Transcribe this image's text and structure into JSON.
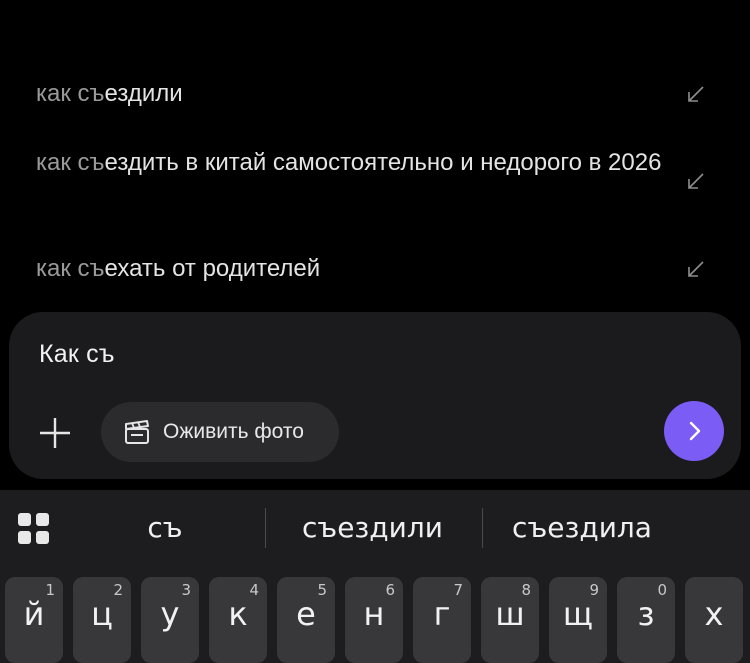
{
  "suggestions": [
    {
      "typed": "как съ",
      "rest": "ездили",
      "icon": "fill-arrow-icon"
    },
    {
      "typed": "как съ",
      "rest": "ездить в китай самостоятельно и недорого в 2026",
      "icon": "fill-arrow-icon"
    },
    {
      "typed": "как съ",
      "rest": "ехать от родителей",
      "icon": "fill-arrow-icon"
    }
  ],
  "composer": {
    "query_text": "Как съ",
    "attach_icon": "plus-icon",
    "animate_photo_label": "Оживить фото",
    "animate_photo_icon": "clapperboard-icon",
    "send_icon": "chevron-right-icon",
    "send_color": "#7b5cf5"
  },
  "keyboard": {
    "menu_icon": "grid-icon",
    "predictions": [
      "съ",
      "съездили",
      "съездила"
    ],
    "keys": [
      {
        "char": "й",
        "num": "1"
      },
      {
        "char": "ц",
        "num": "2"
      },
      {
        "char": "у",
        "num": "3"
      },
      {
        "char": "к",
        "num": "4"
      },
      {
        "char": "е",
        "num": "5"
      },
      {
        "char": "н",
        "num": "6"
      },
      {
        "char": "г",
        "num": "7"
      },
      {
        "char": "ш",
        "num": "8"
      },
      {
        "char": "щ",
        "num": "9"
      },
      {
        "char": "з",
        "num": "0"
      },
      {
        "char": "х",
        "num": ""
      }
    ]
  }
}
